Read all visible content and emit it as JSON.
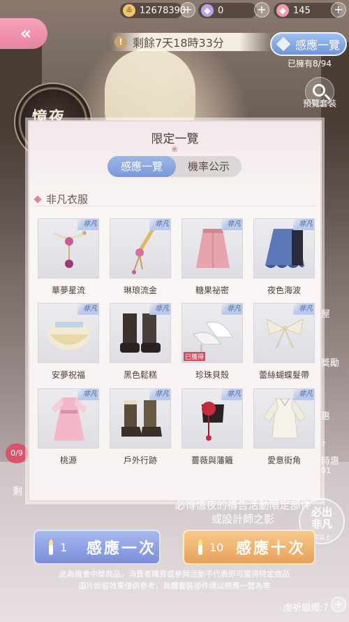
{
  "currency": {
    "gold": "12678398",
    "crystal": "0",
    "diamond": "145",
    "plus": "+"
  },
  "nav": {
    "back_glyph": "«"
  },
  "event": {
    "timer_icon": "!",
    "remaining": "剩餘7天18時33分",
    "medallion_text": "憶夜"
  },
  "collection": {
    "button_label": "感應一覽",
    "owned": "已擁有8/94",
    "preview_label": "預覽套裝"
  },
  "side": {
    "left_progress": "0/9",
    "left_text": "剩",
    "right_texts": [
      "屋",
      "獎勵",
      "惠",
      "7",
      "時惠",
      "01"
    ]
  },
  "modal": {
    "title": "限定一覽",
    "flourish": "❀",
    "tabs": [
      "感應一覽",
      "機率公示"
    ],
    "section_title": "非凡衣服",
    "rare_label": "非凡",
    "obtained_label": "已獲得",
    "items": [
      {
        "name": "華夢星流",
        "art": "necklace",
        "obtained": false
      },
      {
        "name": "琳琅流金",
        "art": "hairpin",
        "obtained": false
      },
      {
        "name": "糖果祕密",
        "art": "skirt-pink",
        "obtained": false
      },
      {
        "name": "夜色海波",
        "art": "skirt-blue",
        "obtained": false
      },
      {
        "name": "安夢祝福",
        "art": "skirt-cream",
        "obtained": false
      },
      {
        "name": "黑色鬆糕",
        "art": "boots-black",
        "obtained": false
      },
      {
        "name": "珍珠貝殼",
        "art": "heels-white",
        "obtained": true
      },
      {
        "name": "蕾絲蝴蝶髮帶",
        "art": "bow",
        "obtained": false
      },
      {
        "name": "桃源",
        "art": "dress-pink",
        "obtained": false
      },
      {
        "name": "戶外行跡",
        "art": "boots-brown",
        "obtained": false
      },
      {
        "name": "薔薇與藩籬",
        "art": "glove",
        "obtained": false
      },
      {
        "name": "愛意街角",
        "art": "blouse",
        "obtained": false
      }
    ]
  },
  "bottom": {
    "guarantee": "必得憶夜的禱告活動限定部件或設計師之影",
    "badge_main": "必出非凡",
    "badge_sub": "次以上",
    "draw_one_count": "1",
    "draw_one_label": "感應一次",
    "draw_ten_count": "10",
    "draw_ten_label": "感應十次",
    "disclaimer_1": "此為機會中獎商品，消費者購買或參與活動不代表即可獲得特定商品",
    "disclaimer_2": "圖片妝容效果僅供參考，具體套裝部件請以感應一覽為準",
    "candles": "虔祈銀燭:7"
  },
  "colors": {
    "accent_blue": "#7b9ad4",
    "accent_pink": "#e9829f",
    "accent_gold": "#e8a15c",
    "obtained_red": "#e0485c"
  }
}
